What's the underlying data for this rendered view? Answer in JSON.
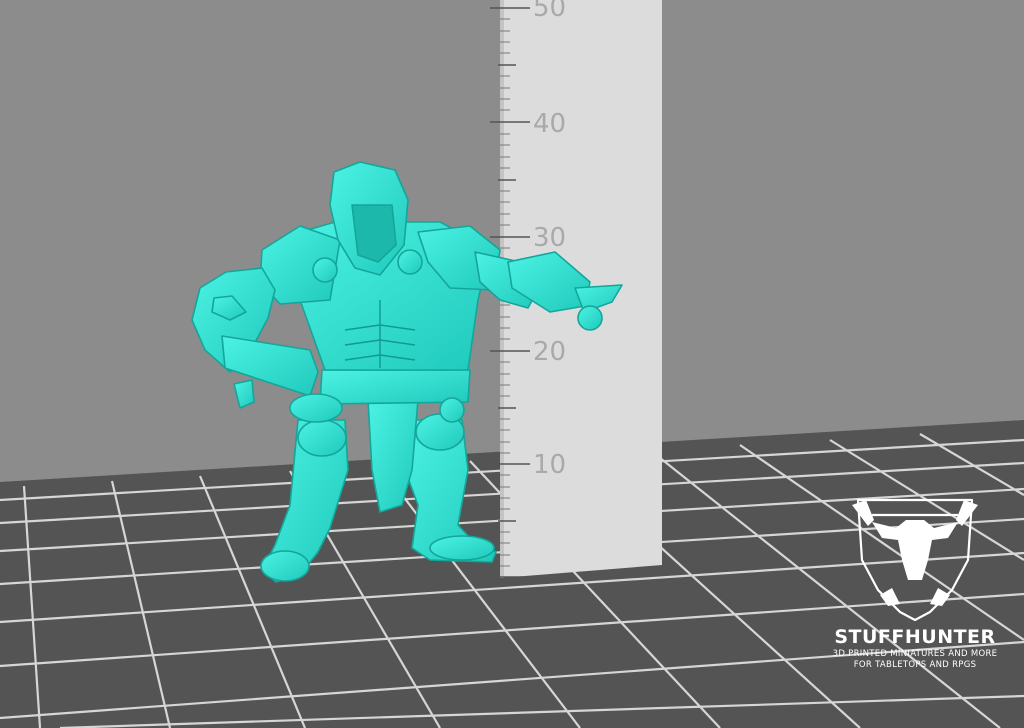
{
  "ruler": {
    "labels": [
      "50",
      "40",
      "30",
      "20",
      "10"
    ]
  },
  "watermark": {
    "brand": "STUFFHUNTER",
    "tagline_1": "3D PRINTED MINIATURES AND MORE",
    "tagline_2": "FOR TABLETOPS AND RPGS"
  },
  "colors": {
    "background": "#8c8c8c",
    "floor": "#545454",
    "grid_lines": "#dadada",
    "model": "#2ee6d6",
    "ruler": "#dcdcdc"
  },
  "icons": {
    "logo": "bull-skull-shield-icon"
  }
}
